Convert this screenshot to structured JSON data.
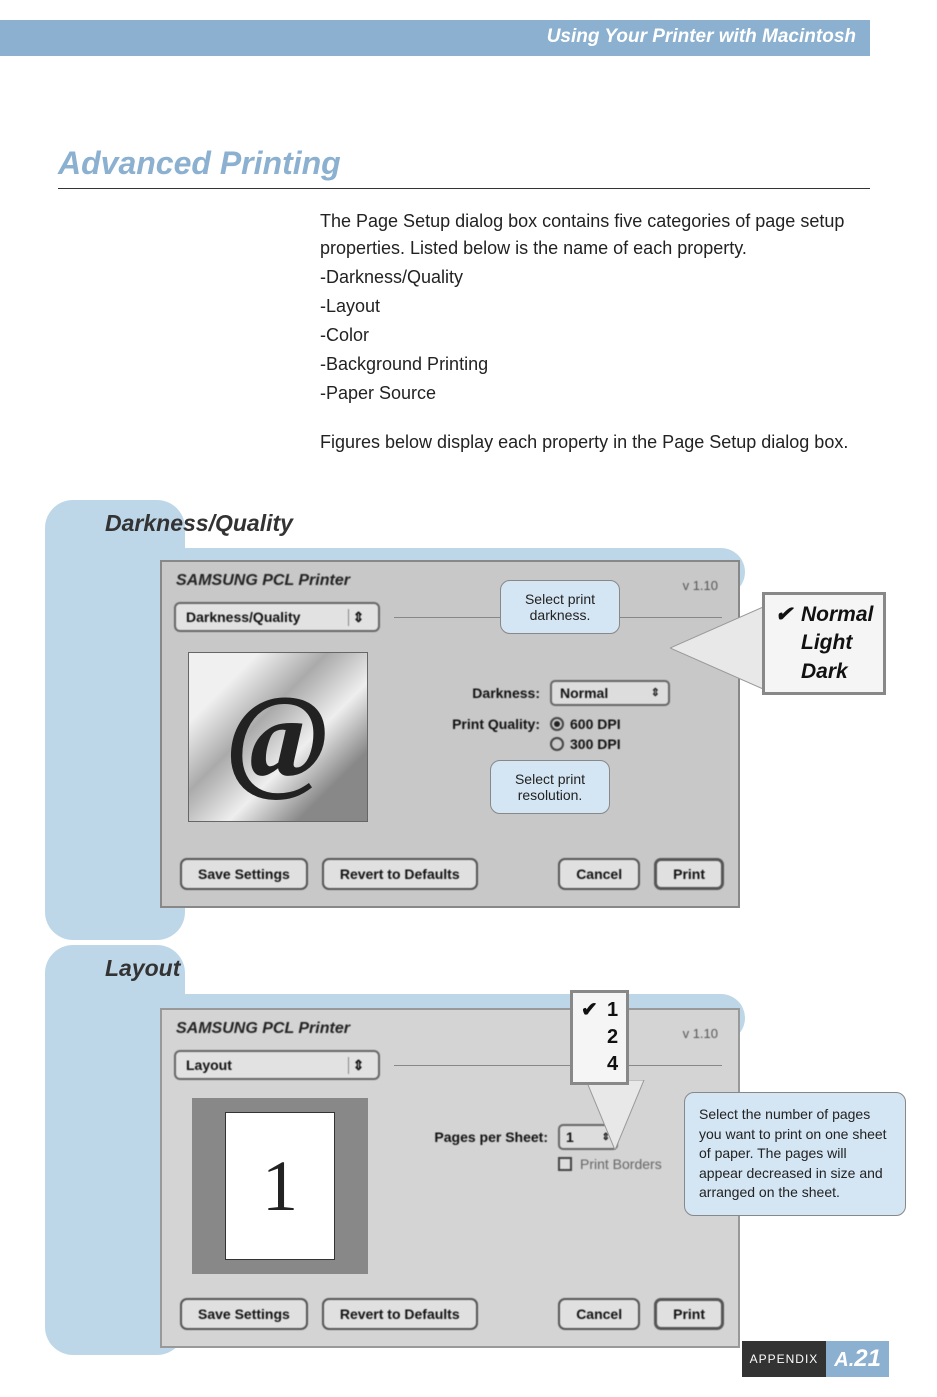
{
  "header": {
    "title": "Using Your Printer with Macintosh"
  },
  "heading": "Advanced Printing",
  "intro": {
    "p1": "The Page Setup dialog box contains five categories of page setup properties. Listed below is the name of each property.",
    "items": [
      "-Darkness/Quality",
      "-Layout",
      "-Color",
      "-Background Printing",
      "-Paper Source"
    ],
    "p2": "Figures below display each property in the Page Setup dialog box."
  },
  "section1": {
    "label": "Darkness/Quality",
    "dialog": {
      "title": "SAMSUNG PCL Printer",
      "version": "v 1.10",
      "tab": "Darkness/Quality",
      "darkness_label": "Darkness:",
      "darkness_value": "Normal",
      "quality_label": "Print Quality:",
      "quality_opt1": "600 DPI",
      "quality_opt2": "300 DPI",
      "btn_save": "Save Settings",
      "btn_revert": "Revert to Defaults",
      "btn_cancel": "Cancel",
      "btn_print": "Print",
      "preview_glyph": "@"
    },
    "callout1": "Select print darkness.",
    "callout2": "Select print resolution.",
    "menu": {
      "opt1": "Normal",
      "opt2": "Light",
      "opt3": "Dark",
      "check": "✔"
    }
  },
  "section2": {
    "label": "Layout",
    "dialog": {
      "title": "SAMSUNG PCL Printer",
      "version": "v 1.10",
      "tab": "Layout",
      "pps_label": "Pages per Sheet:",
      "pps_value": "1",
      "borders_label": "Print Borders",
      "btn_save": "Save Settings",
      "btn_revert": "Revert to Defaults",
      "btn_cancel": "Cancel",
      "btn_print": "Print",
      "preview_glyph": "1"
    },
    "menu": {
      "opt1": "1",
      "opt2": "2",
      "opt3": "4",
      "check": "✔"
    },
    "callout": "Select the number of pages you want to print on one sheet of paper. The pages will appear decreased in size and arranged on the sheet."
  },
  "footer": {
    "appendix": "APPENDIX",
    "page_prefix": "A.",
    "page_num": "21"
  }
}
